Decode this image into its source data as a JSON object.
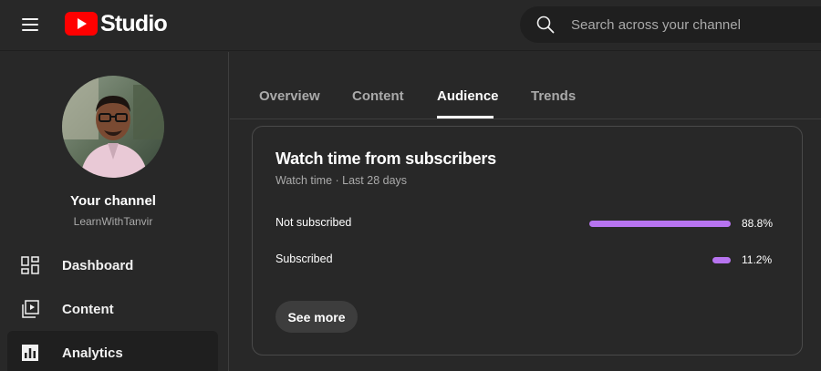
{
  "header": {
    "logo_text": "Studio",
    "search_placeholder": "Search across your channel"
  },
  "sidebar": {
    "channel_title": "Your channel",
    "channel_handle": "LearnWithTanvir",
    "items": [
      {
        "label": "Dashboard",
        "icon": "dashboard-icon"
      },
      {
        "label": "Content",
        "icon": "content-icon"
      },
      {
        "label": "Analytics",
        "icon": "analytics-icon",
        "active": true
      }
    ]
  },
  "tabs": [
    {
      "label": "Overview"
    },
    {
      "label": "Content"
    },
    {
      "label": "Audience",
      "active": true
    },
    {
      "label": "Trends"
    }
  ],
  "card": {
    "title": "Watch time from subscribers",
    "subtitle": "Watch time · Last 28 days",
    "rows": [
      {
        "label": "Not subscribed",
        "value": "88.8%",
        "percent": 88.8
      },
      {
        "label": "Subscribed",
        "value": "11.2%",
        "percent": 11.2
      }
    ],
    "see_more_label": "See more"
  },
  "colors": {
    "background": "#282828",
    "bar": "#b774f0",
    "brand_red": "#ff0000"
  }
}
